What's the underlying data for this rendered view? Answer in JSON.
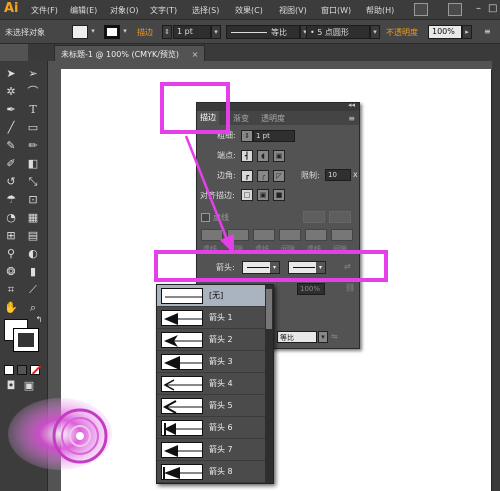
{
  "app": {
    "logo": "Ai"
  },
  "menubar": {
    "items": [
      "文件(F)",
      "编辑(E)",
      "对象(O)",
      "文字(T)",
      "选择(S)",
      "效果(C)",
      "视图(V)",
      "窗口(W)",
      "帮助(H)"
    ],
    "window_controls": [
      "–",
      "□"
    ]
  },
  "controlbar": {
    "selection_status": "未选择对象",
    "stroke_label": "描边",
    "stroke_weight": "1 pt",
    "profile": "等比",
    "brush": "5 点圆形",
    "opacity_label": "不透明度",
    "opacity_value": "100%"
  },
  "document_tab": {
    "title": "未标题-1 @ 100% (CMYK/预览)",
    "close": "×"
  },
  "stroke_panel": {
    "tabs": [
      "描边",
      "渐变",
      "透明度"
    ],
    "weight_label": "粗细:",
    "weight_value": "1 pt",
    "cap_label": "端点:",
    "corner_label": "边角:",
    "limit_label": "限制:",
    "limit_value": "10",
    "limit_unit": "x",
    "align_label": "对齐描边:",
    "dashed_label": "虚线",
    "dash_labels": [
      "虚线",
      "间隙",
      "虚线",
      "间隙",
      "虚线",
      "间隙"
    ],
    "arrowhead_label": "箭头:",
    "scale_value": "100%",
    "profile_value": "等比"
  },
  "arrow_dropdown": {
    "items": [
      "[无]",
      "箭头 1",
      "箭头 2",
      "箭头 3",
      "箭头 4",
      "箭头 5",
      "箭头 6",
      "箭头 7",
      "箭头 8"
    ]
  },
  "colors": {
    "highlight": "#e43fe9",
    "accent_orange": "#f39a1e",
    "panel_bg": "#535353"
  }
}
